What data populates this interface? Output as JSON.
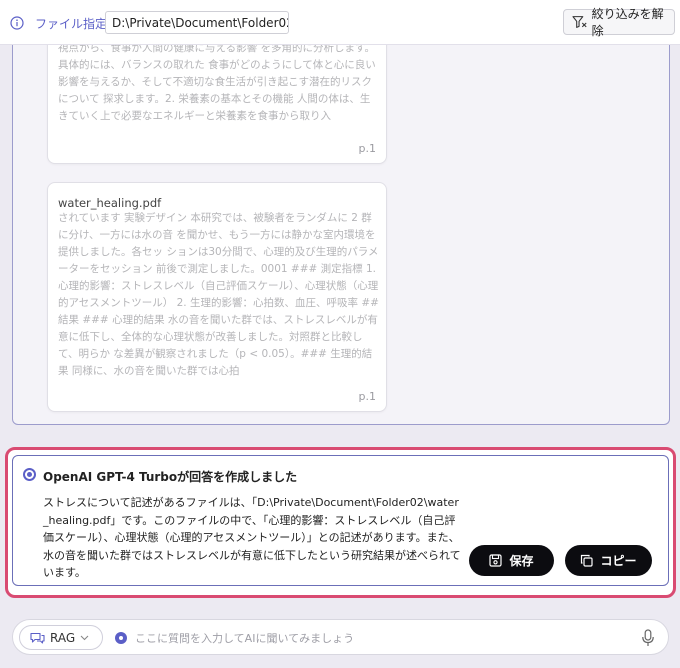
{
  "header": {
    "file_label": "ファイル指定",
    "path_value": "D:\\Private\\Document\\Folder02\\",
    "filter_button": "絞り込みを解除"
  },
  "results": [
    {
      "title": "",
      "text": "視点から、食事が人間の健康に与える影響 を多角的に分析します。具体的には、バランスの取れた 食事がどのようにして体と心に良い影響を与えるか、そして不適切な食生活が引き起こす潜在的リスクについて 探求します。2. 栄養素の基本とその機能 人間の体は、生きていく上で必要なエネルギーと栄養素を食事から取り入",
      "page": "p.1"
    },
    {
      "title": "water_healing.pdf",
      "text": "されています 実験デザイン 本研究では、被験者をランダムに 2 群に分け、一方には水の音 を聞かせ、もう一方には静かな室内環境を提供しました。各セッ ションは30分間で、心理的及び生理的パラメーターをセッション 前後で測定しました。0001 ### 測定指標 1. 心理的影響：ストレスレベル（自己評価スケール）、心理状態（心理的アセスメントツール） 2. 生理的影響：心拍数、血圧、呼吸率 ## 結果 ### 心理的結果 水の音を聞いた群では、ストレスレベルが有意に低下し、全体的な心理状態が改善しました。対照群と比較して、明らか な差異が観察されました（p < 0.05）。### 生理的結果 同様に、水の音を聞いた群では心拍",
      "page": "p.1"
    }
  ],
  "answer": {
    "model_status": "OpenAI GPT-4 Turboが回答を作成しました",
    "text": "ストレスについて記述があるファイルは、「D:\\Private\\Document\\Folder02\\water_healing.pdf」です。このファイルの中で、「心理的影響：ストレスレベル（自己評価スケール）、心理状態（心理的アセスメントツール）」との記述があります。また、水の音を聞いた群ではストレスレベルが有意に低下したという研究結果が述べられています。",
    "save_label": "保存",
    "copy_label": "コピー"
  },
  "input": {
    "mode": "RAG",
    "placeholder": "ここに質問を入力してAIに聞いてみましょう"
  },
  "colors": {
    "accent": "#5b5fc7",
    "highlight_border": "#d94b72",
    "button_dark": "#0c0c10"
  },
  "icons": [
    "info-icon",
    "filter-clear-icon",
    "save-icon",
    "copy-icon",
    "rag-icon",
    "chevron-down-icon",
    "mic-icon"
  ]
}
